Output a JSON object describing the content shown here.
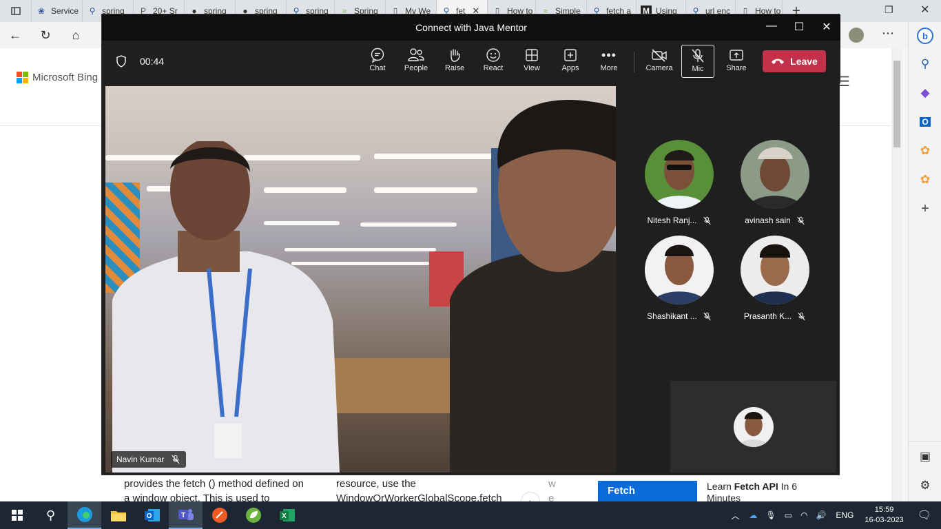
{
  "browser": {
    "tabs": [
      {
        "label": "Service",
        "icon": "page-icon"
      },
      {
        "label": "spring",
        "icon": "search-icon"
      },
      {
        "label": "20+ Sr",
        "icon": "p-icon"
      },
      {
        "label": "spring",
        "icon": "github-icon"
      },
      {
        "label": "spring",
        "icon": "github-icon"
      },
      {
        "label": "spring",
        "icon": "search-icon"
      },
      {
        "label": "Spring",
        "icon": "spring-icon"
      },
      {
        "label": "My We",
        "icon": "page-icon"
      },
      {
        "label": "fet",
        "icon": "search-icon"
      },
      {
        "label": "How to",
        "icon": "page-icon"
      },
      {
        "label": "Simple",
        "icon": "spring-icon"
      },
      {
        "label": "fetch a",
        "icon": "search-icon"
      },
      {
        "label": "Using",
        "icon": "m-icon"
      },
      {
        "label": "url enc",
        "icon": "search-icon"
      },
      {
        "label": "How to",
        "icon": "page-icon"
      }
    ]
  },
  "bing": {
    "logo_text": "Microsoft Bing",
    "snippet1": "provides the fetch () method defined on a window object. This is used to",
    "snippet2": "resource, use the WindowOrWorkerGlobalScope.fetch",
    "snippet3": "w e",
    "related_thumb": "Fetch",
    "related_title_prefix": "Learn ",
    "related_title_bold": "Fetch API",
    "related_title_suffix": " In 6 Minutes"
  },
  "teams": {
    "window_title": "Connect with Java Mentor",
    "timer": "00:44",
    "toolbar": {
      "chat": "Chat",
      "people": "People",
      "raise": "Raise",
      "react": "React",
      "view": "View",
      "apps": "Apps",
      "more": "More",
      "camera": "Camera",
      "mic": "Mic",
      "share": "Share",
      "leave": "Leave"
    },
    "main_speaker": "Navin Kumar",
    "participants": [
      {
        "name": "Nitesh Ranj..."
      },
      {
        "name": "avinash sain"
      },
      {
        "name": "Shashikant ..."
      },
      {
        "name": "Prasanth K..."
      }
    ]
  },
  "taskbar": {
    "language": "ENG",
    "time": "15:59",
    "date": "16-03-2023"
  },
  "colors": {
    "leave": "#c4314b",
    "teams_bg": "#1f1f1f",
    "taskbar": "#1c2733"
  }
}
